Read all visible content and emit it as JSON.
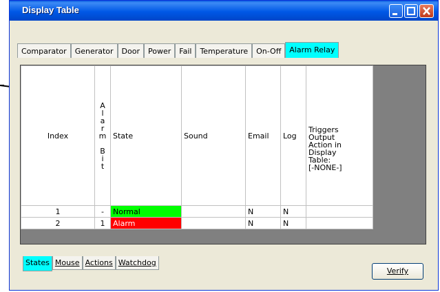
{
  "window": {
    "title": "Display Table"
  },
  "tabs_top": [
    {
      "label": "Comparator",
      "active": false
    },
    {
      "label": "Generator",
      "active": false
    },
    {
      "label": "Door",
      "active": false
    },
    {
      "label": "Power",
      "active": false
    },
    {
      "label": "Fail",
      "active": false
    },
    {
      "label": "Temperature",
      "active": false
    },
    {
      "label": "On-Off",
      "active": false
    },
    {
      "label": "Alarm Relay",
      "active": true
    }
  ],
  "table": {
    "headers": {
      "index": "Index",
      "alarm_bit": [
        "A",
        "l",
        "a",
        "r",
        "m",
        "",
        "B",
        "i",
        "t"
      ],
      "state": "State",
      "sound": "Sound",
      "email": "Email",
      "log": "Log",
      "triggers": [
        "Triggers",
        "Output",
        "Action in",
        "Display",
        "Table:",
        "[-NONE-]"
      ]
    },
    "rows": [
      {
        "index": "1",
        "bit": "-",
        "state": "Normal",
        "sound": "",
        "email": "N",
        "log": "N",
        "state_color": "#00ff00"
      },
      {
        "index": "2",
        "bit": "1",
        "state": "Alarm",
        "sound": "",
        "email": "N",
        "log": "N",
        "state_color": "#ff0000"
      }
    ]
  },
  "tabs_bottom": [
    {
      "label": "States",
      "active": true
    },
    {
      "label": "Mouse",
      "active": false
    },
    {
      "label": "Actions",
      "active": false
    },
    {
      "label": "Watchdog",
      "active": false
    }
  ],
  "buttons": {
    "verify": "Verify"
  },
  "colors": {
    "active_tab": "#00ffff",
    "normal": "#00ff00",
    "alarm": "#ff0000",
    "titlebar": "#0058e6"
  }
}
